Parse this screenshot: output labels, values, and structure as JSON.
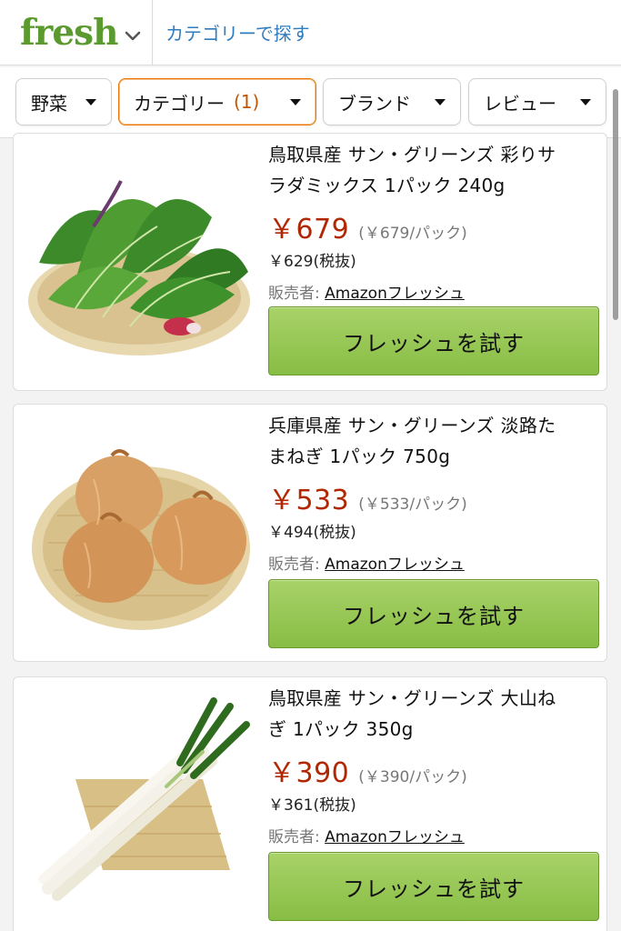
{
  "header": {
    "logo": "fresh",
    "category_link": "カテゴリーで探す"
  },
  "filters": [
    {
      "label": "野菜",
      "count": ""
    },
    {
      "label": "カテゴリー",
      "count": "(1)"
    },
    {
      "label": "ブランド",
      "count": ""
    },
    {
      "label": "レビュー",
      "count": ""
    }
  ],
  "colors": {
    "brand_green": "#5b9a2f",
    "price_red": "#b12704",
    "button_green": "#8fc24a",
    "active_filter": "#e77600"
  },
  "products": [
    {
      "title_line1": "鳥取県産 サン・グリーンズ 彩りサ",
      "title_line2": "ラダミックス 1パック 240g",
      "price": "￥679",
      "unit_price": "(￥679/パック)",
      "tax_excluded": "￥629(税抜)",
      "seller_label": "販売者:",
      "seller_name": "Amazonフレッシュ",
      "button": "フレッシュを試す",
      "image": "salad-mix-image"
    },
    {
      "title_line1": "兵庫県産 サン・グリーンズ 淡路た",
      "title_line2": "まねぎ 1パック 750g",
      "price": "￥533",
      "unit_price": "(￥533/パック)",
      "tax_excluded": "￥494(税抜)",
      "seller_label": "販売者:",
      "seller_name": "Amazonフレッシュ",
      "button": "フレッシュを試す",
      "image": "onions-image"
    },
    {
      "title_line1": "鳥取県産 サン・グリーンズ 大山ね",
      "title_line2": "ぎ 1パック 350g",
      "price": "￥390",
      "unit_price": "(￥390/パック)",
      "tax_excluded": "￥361(税抜)",
      "seller_label": "販売者:",
      "seller_name": "Amazonフレッシュ",
      "button": "フレッシュを試す",
      "image": "green-onion-image"
    }
  ]
}
